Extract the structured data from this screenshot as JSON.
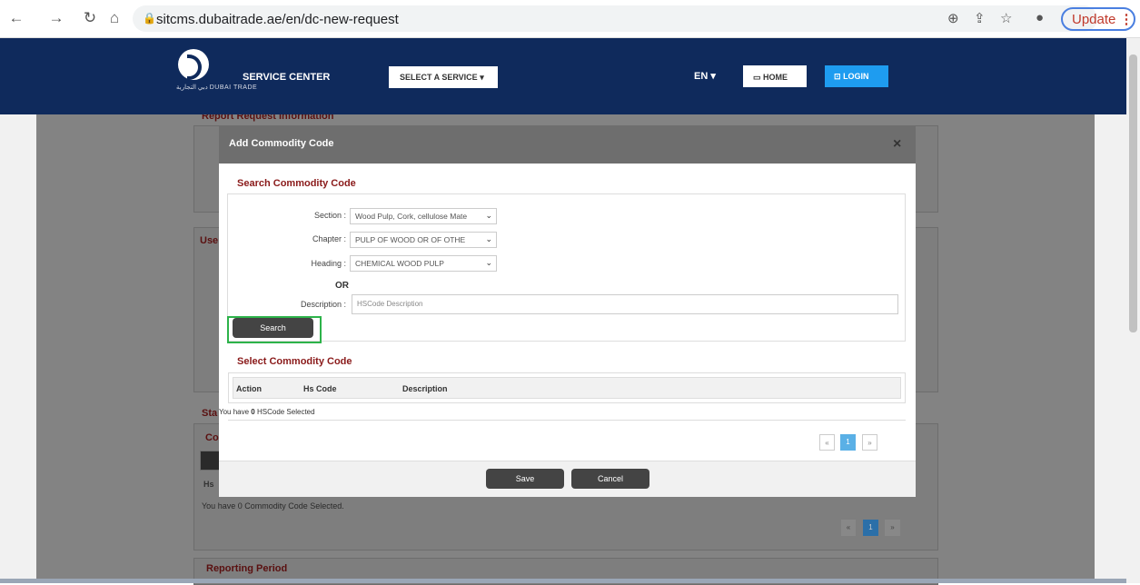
{
  "browser": {
    "url": "sitcms.dubaitrade.ae/en/dc-new-request",
    "update_label": "Update"
  },
  "header": {
    "logo_text": "دبي التجارية DUBAI TRADE",
    "service_center": "SERVICE CENTER",
    "select_service": "SELECT A SERVICE",
    "lang": "EN",
    "home": "HOME",
    "login": "LOGIN"
  },
  "background": {
    "report_request_info": "Report Request Information",
    "use_label": "Use",
    "sta_label": "Sta",
    "co_label": "Co",
    "hs_label": "Hs",
    "commodity_selected": "You have 0 Commodity Code Selected.",
    "reporting_period": "Reporting Period",
    "page_num": "1"
  },
  "modal": {
    "title": "Add Commodity Code",
    "close": "×",
    "search_title": "Search Commodity Code",
    "fields": {
      "section_label": "Section",
      "section_value": "Wood Pulp, Cork, cellulose Mate",
      "chapter_label": "Chapter",
      "chapter_value": "PULP OF WOOD OR OF OTHE",
      "heading_label": "Heading",
      "heading_value": "CHEMICAL WOOD PULP",
      "or": "OR",
      "description_label": "Description",
      "description_placeholder": "HSCode Description"
    },
    "search_btn": "Search",
    "select_title": "Select Commodity Code",
    "table": {
      "col_action": "Action",
      "col_hscode": "Hs Code",
      "col_description": "Description"
    },
    "selected_prefix": "You have ",
    "selected_count": "0",
    "selected_suffix": " HSCode Selected",
    "pagination": {
      "prev": "«",
      "page": "1",
      "next": "»"
    },
    "save": "Save",
    "cancel": "Cancel"
  }
}
